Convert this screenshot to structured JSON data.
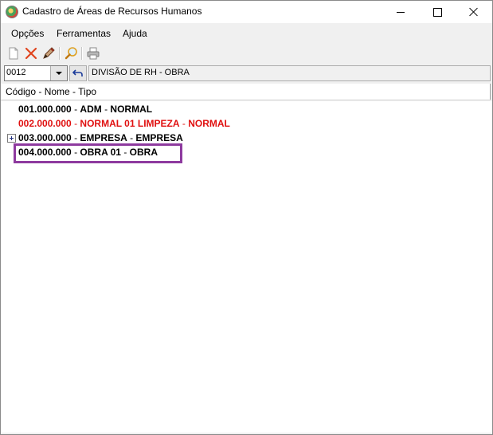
{
  "window": {
    "title": "Cadastro de Áreas de Recursos Humanos",
    "icon": "app-globe-icon"
  },
  "menu": {
    "items": [
      {
        "label": "Opções"
      },
      {
        "label": "Ferramentas"
      },
      {
        "label": "Ajuda"
      }
    ]
  },
  "toolbar": {
    "buttons": [
      {
        "icon": "new-document-icon"
      },
      {
        "icon": "delete-x-icon"
      },
      {
        "icon": "edit-pencil-icon"
      },
      {
        "icon": "search-magnifier-icon"
      },
      {
        "icon": "printer-icon"
      }
    ]
  },
  "selector": {
    "code_value": "0012",
    "description_value": "DIVISÃO DE RH - OBRA"
  },
  "tree": {
    "header": "Código - Nome - Tipo",
    "rows": [
      {
        "code": "001.000.000",
        "name": "ADM",
        "type": "NORMAL",
        "color": "#000000"
      },
      {
        "code": "002.000.000",
        "name": "NORMAL 01 LIMPEZA",
        "type": "NORMAL",
        "color": "#e01010"
      },
      {
        "code": "003.000.000",
        "name": "EMPRESA",
        "type": "EMPRESA",
        "color": "#000000",
        "expandable": true
      },
      {
        "code": "004.000.000",
        "name": "OBRA 01",
        "type": "OBRA",
        "color": "#000000",
        "highlighted": true
      }
    ],
    "separator": " - ",
    "highlight_color": "#8e3a9f"
  }
}
